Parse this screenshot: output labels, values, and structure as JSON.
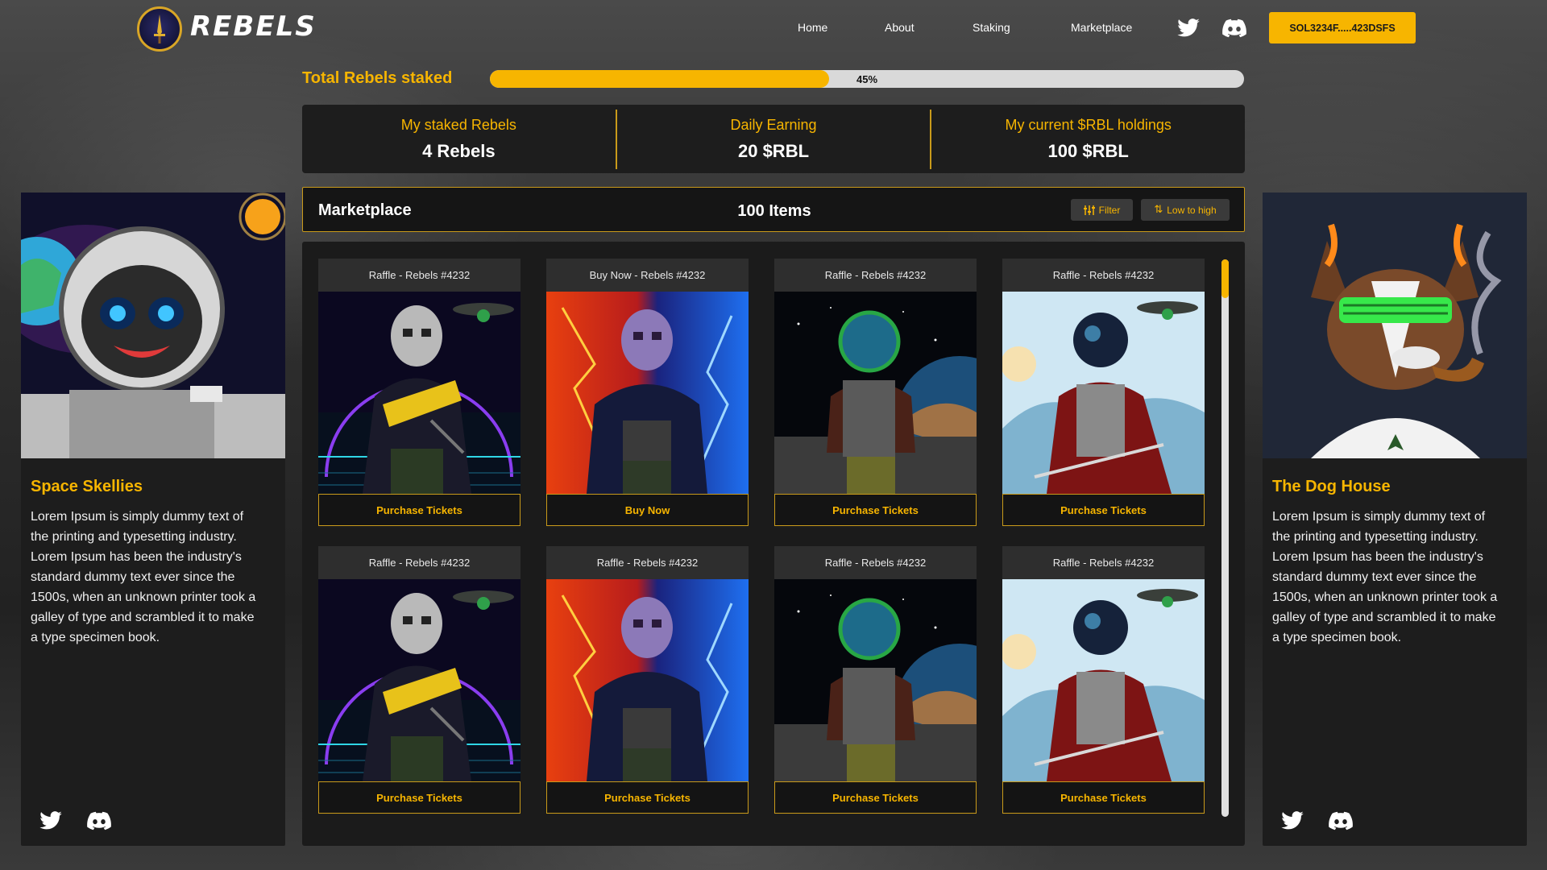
{
  "header": {
    "brand": "REBELS",
    "nav": [
      "Home",
      "About",
      "Staking",
      "Marketplace"
    ],
    "wallet": "SOL3234F.....423DSFS"
  },
  "staking": {
    "label": "Total Rebels staked",
    "percent": 45,
    "percent_label": "45%"
  },
  "stats": [
    {
      "label": "My staked Rebels",
      "value": "4 Rebels"
    },
    {
      "label": "Daily Earning",
      "value": "20 $RBL"
    },
    {
      "label": "My current $RBL holdings",
      "value": "100 $RBL"
    }
  ],
  "marketplace": {
    "title": "Marketplace",
    "count": "100 Items",
    "filter_label": "Filter",
    "sort_label": "Low to high",
    "cards": [
      {
        "title": "Raffle - Rebels #4232",
        "button": "Purchase Tickets",
        "art": "cyber-skull-yellow"
      },
      {
        "title": "Buy Now - Rebels #4232",
        "button": "Buy Now",
        "art": "fire-ice-purple"
      },
      {
        "title": "Raffle - Rebels #4232",
        "button": "Purchase Tickets",
        "art": "space-moon-green"
      },
      {
        "title": "Raffle - Rebels #4232",
        "button": "Purchase Tickets",
        "art": "icy-planet-red"
      },
      {
        "title": "Raffle - Rebels #4232",
        "button": "Purchase Tickets",
        "art": "cyber-skull-yellow"
      },
      {
        "title": "Raffle - Rebels #4232",
        "button": "Purchase Tickets",
        "art": "fire-ice-purple"
      },
      {
        "title": "Raffle - Rebels #4232",
        "button": "Purchase Tickets",
        "art": "space-moon-green"
      },
      {
        "title": "Raffle - Rebels #4232",
        "button": "Purchase Tickets",
        "art": "icy-planet-red"
      }
    ]
  },
  "left_panel": {
    "title": "Space Skellies",
    "description": "Lorem Ipsum is simply dummy text of the printing and typesetting industry. Lorem Ipsum has been the industry's standard dummy text ever since the 1500s, when an unknown printer took a galley of type and scrambled it to make a type specimen book.",
    "art": "astronaut-skull"
  },
  "right_panel": {
    "title": "The Dog House",
    "description": "Lorem Ipsum is simply dummy text of the printing and typesetting industry. Lorem Ipsum has been the industry's standard dummy text ever since the 1500s, when an unknown printer took a galley of type and scrambled it to make a type specimen book.",
    "art": "smoking-dog"
  },
  "icons": {
    "twitter": "twitter-icon",
    "discord": "discord-icon",
    "filter": "sliders-icon",
    "sort": "sort-arrows-icon"
  },
  "colors": {
    "accent": "#f7b500",
    "panel": "#1d1d1d",
    "card_border": "#c99a1a"
  }
}
